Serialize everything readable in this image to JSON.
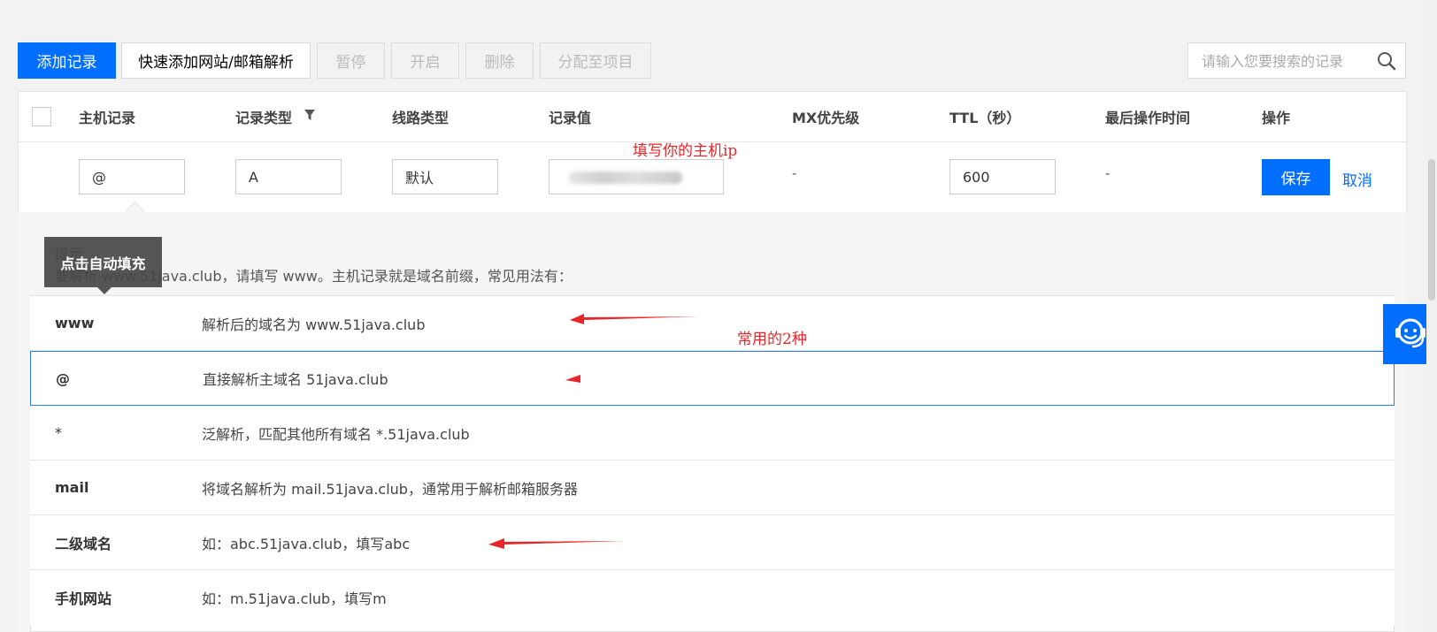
{
  "toolbar": {
    "add_record": "添加记录",
    "quick_add": "快速添加网站/邮箱解析",
    "pause": "暂停",
    "enable": "开启",
    "delete": "删除",
    "assign_project": "分配至项目",
    "search_placeholder": "请输入您要搜索的记录"
  },
  "table": {
    "headers": {
      "host": "主机记录",
      "type": "记录类型",
      "line": "线路类型",
      "value": "记录值",
      "mx": "MX优先级",
      "ttl": "TTL（秒）",
      "last_op": "最后操作时间",
      "actions": "操作"
    },
    "edit_row": {
      "host": "@",
      "type": "A",
      "line": "默认",
      "value": "",
      "mx": "-",
      "ttl": "600",
      "last_op": "-",
      "save": "保存",
      "cancel": "取消"
    }
  },
  "hint": {
    "title": "提示",
    "text": "要解析 www.51java.club，请填写 www。主机记录就是域名前缀，常见用法有：",
    "tooltip": "点击自动填充"
  },
  "options": [
    {
      "key": "www",
      "desc": "解析后的域名为 www.51java.club"
    },
    {
      "key": "@",
      "desc": "直接解析主域名 51java.club"
    },
    {
      "key": "*",
      "desc": "泛解析，匹配其他所有域名 *.51java.club"
    },
    {
      "key": "mail",
      "desc": "将域名解析为 mail.51java.club，通常用于解析邮箱服务器"
    },
    {
      "key": "二级域名",
      "desc": "如：abc.51java.club，填写abc"
    },
    {
      "key": "手机网站",
      "desc": "如：m.51java.club，填写m"
    }
  ],
  "annotations": {
    "host_ip": "填写你的主机ip",
    "common_two": "常用的2种"
  },
  "colors": {
    "primary": "#006eff",
    "annotation": "#e8262a",
    "selected_border": "#2a7de1"
  }
}
